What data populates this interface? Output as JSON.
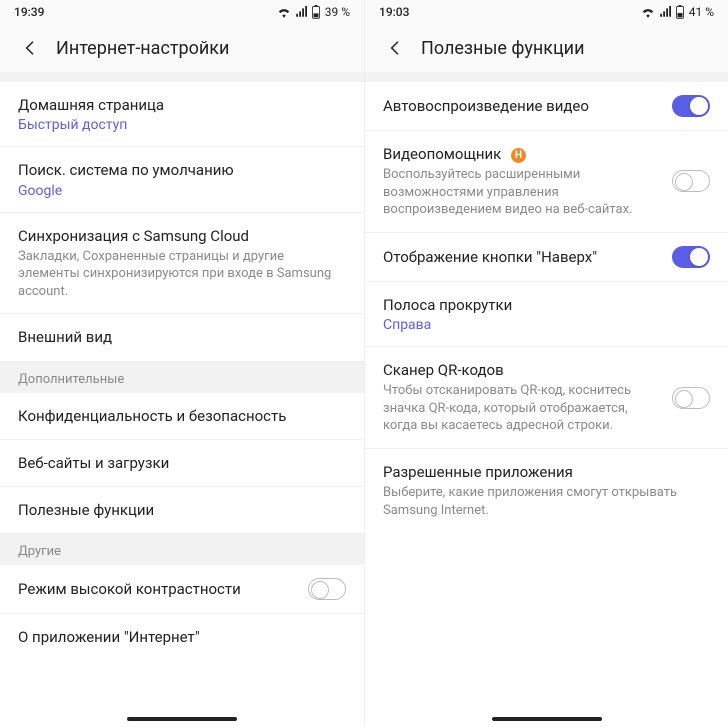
{
  "left": {
    "status": {
      "time": "19:39",
      "battery": "39 %"
    },
    "header": {
      "title": "Интернет-настройки"
    },
    "rows": {
      "home": {
        "title": "Домашняя страница",
        "link": "Быстрый доступ"
      },
      "search": {
        "title": "Поиск. система по умолчанию",
        "link": "Google"
      },
      "sync": {
        "title": "Синхронизация с Samsung Cloud",
        "sub": "Закладки, Сохраненные страницы и другие элементы синхронизируются при входе в Samsung account."
      },
      "appearance": {
        "title": "Внешний вид"
      },
      "privacy": {
        "title": "Конфиденциальность и безопасность"
      },
      "sites": {
        "title": "Веб-сайты и загрузки"
      },
      "useful": {
        "title": "Полезные функции"
      },
      "contrast": {
        "title": "Режим высокой контрастности"
      },
      "about": {
        "title": "О приложении \"Интернет\""
      }
    },
    "sections": {
      "more": "Дополнительные",
      "other": "Другие"
    }
  },
  "right": {
    "status": {
      "time": "19:03",
      "battery": "41 %"
    },
    "header": {
      "title": "Полезные функции"
    },
    "rows": {
      "autoplay": {
        "title": "Автовоспроизведение видео"
      },
      "videoasst": {
        "title": "Видеопомощник",
        "badge": "Н",
        "sub": "Воспользуйтесь расширенными возможностями управления воспроизведением видео на веб-сайтах."
      },
      "topbtn": {
        "title": "Отображение кнопки \"Наверх\""
      },
      "scroll": {
        "title": "Полоса прокрутки",
        "link": "Справа"
      },
      "qr": {
        "title": "Сканер QR-кодов",
        "sub": "Чтобы отсканировать QR-код, коснитесь значка QR-кода, который отображается, когда вы касаетесь адресной строки."
      },
      "apps": {
        "title": "Разрешенные приложения",
        "sub": "Выберите, какие приложения смогут открывать Samsung Internet."
      }
    }
  }
}
